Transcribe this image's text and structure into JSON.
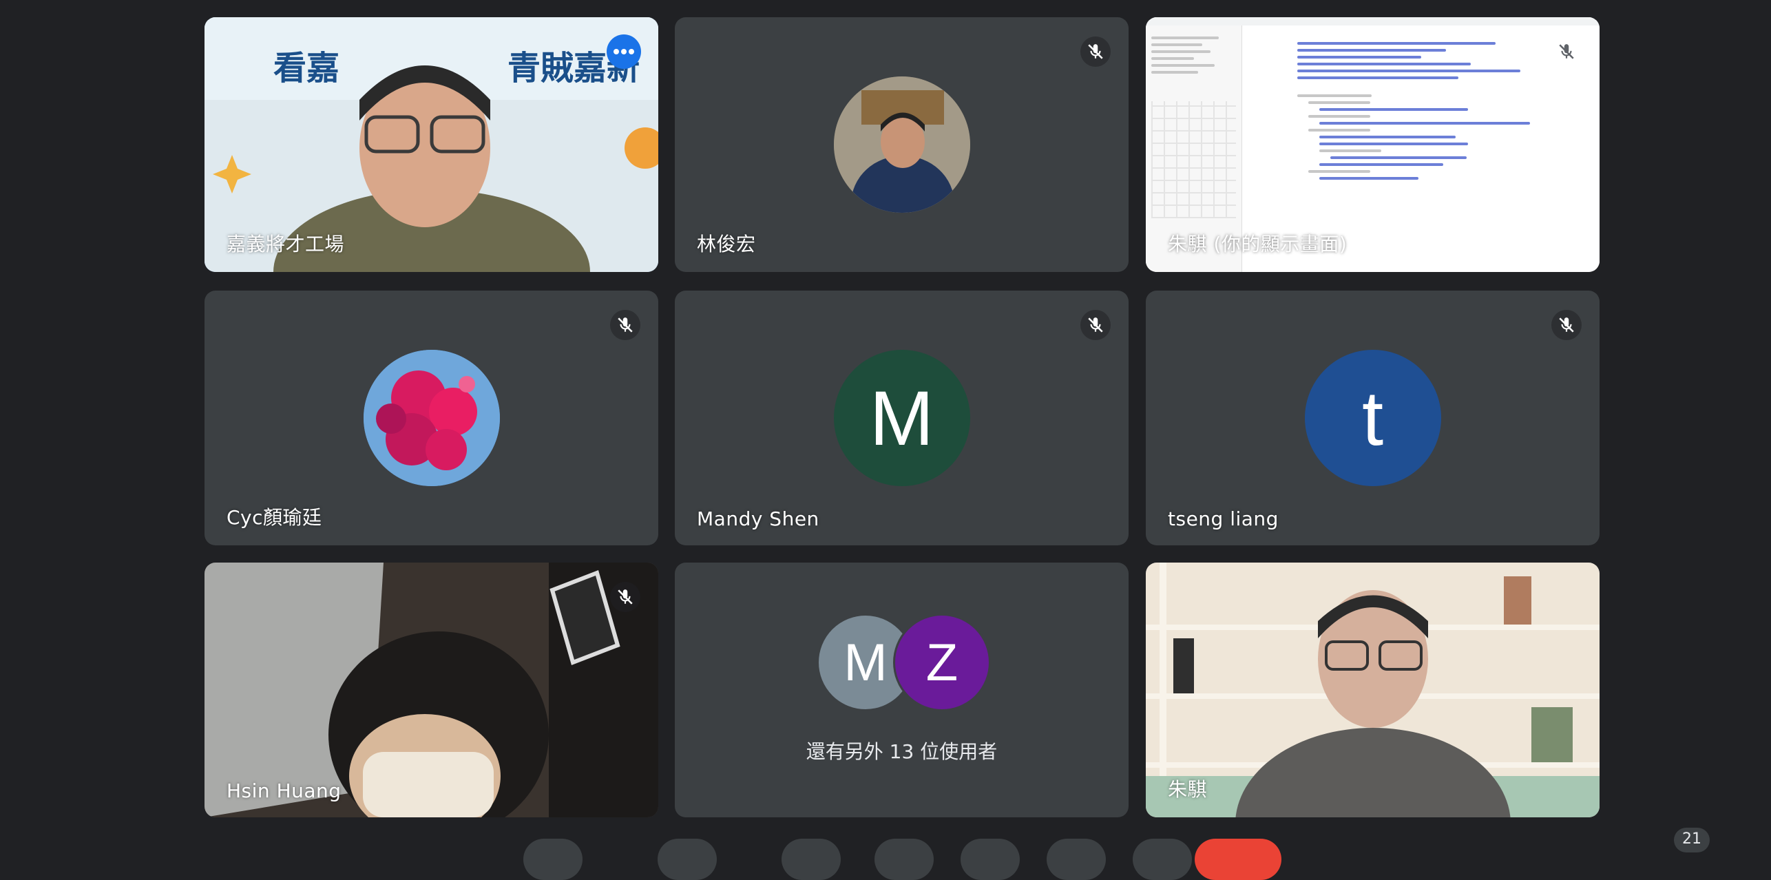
{
  "participants": [
    {
      "name": "嘉義將才工場",
      "muted": false,
      "speaking": true,
      "type": "video"
    },
    {
      "name": "林俊宏",
      "muted": true,
      "type": "photo"
    },
    {
      "name": "朱騏 (你的顯示畫面)",
      "muted": true,
      "type": "screen-share"
    },
    {
      "name": "Cyc顏瑜廷",
      "muted": true,
      "type": "photo"
    },
    {
      "name": "Mandy Shen",
      "muted": true,
      "type": "initial",
      "initial": "M",
      "color": "#1e4d3b"
    },
    {
      "name": "tseng liang",
      "muted": true,
      "type": "initial",
      "initial": "t",
      "color": "#1f4f93"
    },
    {
      "name": "Hsin Huang",
      "muted": true,
      "type": "video"
    },
    {
      "name": "朱騏",
      "muted": false,
      "type": "video"
    }
  ],
  "others": {
    "text": "還有另外 13 位使用者",
    "avatars": [
      {
        "initial": "M",
        "color": "#7b8b96"
      },
      {
        "initial": "Z",
        "color": "#6a1b9a"
      }
    ]
  },
  "participant_count": "21",
  "colors": {
    "background": "#202124",
    "tile": "#3c4043",
    "active_border": "#8ab4f8",
    "end_call": "#ea4335"
  },
  "icons": [
    "mic-off-icon",
    "more-options-icon"
  ]
}
